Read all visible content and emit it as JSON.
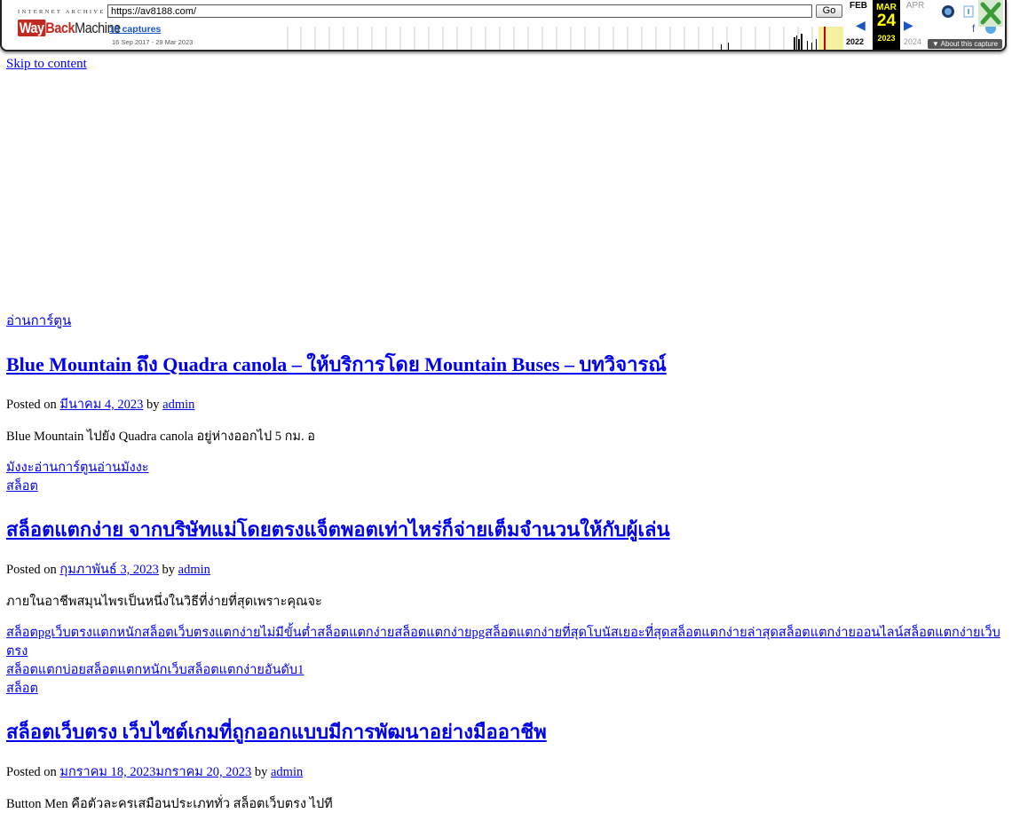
{
  "toolbar": {
    "brand_top": "INTERNET ARCHIVE",
    "brand_way": "Way",
    "brand_back": "Back",
    "brand_machine": "Machine",
    "url_value": "https://av8188.com/",
    "go_label": "Go",
    "captures_label": "19 captures",
    "date_range": "16 Sep 2017 - 29 Mar 2023",
    "month_prev": "FEB",
    "month_current": "MAR",
    "month_next": "APR",
    "day_current": "24",
    "year_prev": "2022",
    "year_current": "2023",
    "year_next": "2024",
    "about_label": "▼ About this capture",
    "facebook_glyph": "f"
  },
  "page": {
    "skip_link": "Skip to content",
    "category_link": "อ่านการ์ตูน",
    "posted_on": "Posted on",
    "by": "by"
  },
  "posts": [
    {
      "title": "Blue Mountain ถึง Quadra canola – ให้บริการโดย Mountain Buses – บทวิจารณ์",
      "date": "มีนาคม 4, 2023",
      "author": "admin",
      "excerpt": "Blue Mountain ไปยัง Quadra canola อยู่ห่างออกไป 5 กม. อ",
      "tags": [
        "มังงะอ่านการ์ตูนอ่านมังงะ"
      ],
      "category": "สล็อต"
    },
    {
      "title": "สล็อตแตกง่าย จากบริษัทแม่โดยตรงแจ็ตพอตเท่าไหร่ก็จ่ายเต็มจำนวนให้กับผู้เล่น",
      "date": "กุมภาพันธ์ 3, 2023",
      "author": "admin",
      "excerpt": "ภายในอาชีพสมุนไพรเป็นหนึ่งในวิธีที่ง่ายที่สุดเพราะคุณจะ",
      "tags_line1": "สล็อตpgเว็บตรงแตกหนักสล็อตเว็บตรงแตกง่ายไม่มีขั้นต่ำสล็อตแตกง่ายสล็อตแตกง่ายpgสล็อตแตกง่ายที่สุดโบนัสเยอะที่สุดสล็อตแตกง่ายล่าสุดสล็อตแตกง่ายออนไลน์สล็อตแตกง่ายเว็บตรง",
      "tags_line2": "สล็อตแตกบ่อยสล็อตแตกหนักเว็บสล็อตแตกง่ายอันดับ1",
      "category": "สล็อต"
    },
    {
      "title": "สล็อตเว็บตรง เว็บไซต์เกมที่ถูกออกแบบมีการพัฒนาอย่างมืออาชีพ",
      "date": "มกราคม 18, 2023มกราคม 20, 2023",
      "author": "admin",
      "excerpt": "Button Men คือตัวละครเสมือนประเภททั่ว สล็อตเว็บตรง ไปที"
    }
  ]
}
